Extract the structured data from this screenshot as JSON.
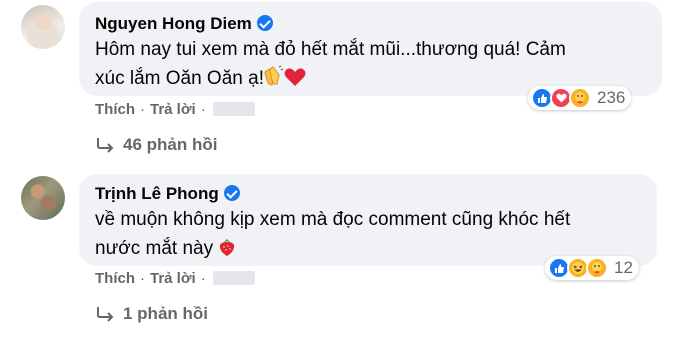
{
  "comments": [
    {
      "author": "Nguyen Hong Diem",
      "text_line1": "Hôm nay tui xem mà đỏ hết mắt mũi...thương quá! Cảm",
      "text_line2": "xúc lắm Oăn Oăn ạ!",
      "emojis": [
        "clapping-hands",
        "red-heart"
      ],
      "reactions": [
        "like",
        "love",
        "care"
      ],
      "reaction_count": "236",
      "like_label": "Thích",
      "reply_label": "Trả lời",
      "replies_label": "46 phản hồi"
    },
    {
      "author": "Trịnh Lê Phong",
      "text_line1": "về muộn không kịp xem mà đọc comment cũng khóc hết",
      "text_line2": "nước mắt này",
      "emojis": [
        "strawberry"
      ],
      "reactions": [
        "like",
        "haha",
        "care"
      ],
      "reaction_count": "12",
      "like_label": "Thích",
      "reply_label": "Trả lời",
      "replies_label": "1 phản hồi"
    }
  ],
  "colors": {
    "bubble": "#f0f2f5",
    "verified": "#1877f2",
    "meta_text": "#65676b",
    "like": "#1877f2",
    "love": "#f33e58",
    "care": "#f7b125"
  }
}
